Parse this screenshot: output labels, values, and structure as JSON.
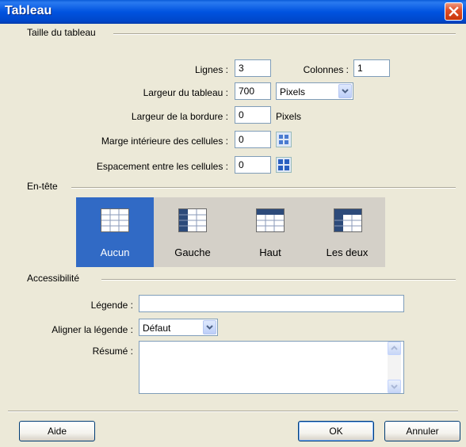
{
  "window": {
    "title": "Tableau"
  },
  "table_size": {
    "legend": "Taille du tableau",
    "rows_label": "Lignes :",
    "rows_value": "3",
    "columns_label": "Colonnes :",
    "columns_value": "1",
    "width_label": "Largeur du tableau :",
    "width_value": "700",
    "width_unit": "Pixels",
    "border_label": "Largeur de la bordure :",
    "border_value": "0",
    "border_unit": "Pixels",
    "padding_label": "Marge intérieure des cellules :",
    "padding_value": "0",
    "spacing_label": "Espacement entre les cellules :",
    "spacing_value": "0"
  },
  "header": {
    "legend": "En-tête",
    "options": [
      {
        "label": "Aucun",
        "icon": "table-no-header-icon",
        "selected": true
      },
      {
        "label": "Gauche",
        "icon": "table-left-header-icon",
        "selected": false
      },
      {
        "label": "Haut",
        "icon": "table-top-header-icon",
        "selected": false
      },
      {
        "label": "Les deux",
        "icon": "table-both-header-icon",
        "selected": false
      }
    ]
  },
  "accessibility": {
    "legend": "Accessibilité",
    "caption_label": "Légende :",
    "caption_value": "",
    "align_label": "Aligner la légende :",
    "align_value": "Défaut",
    "summary_label": "Résumé :",
    "summary_value": ""
  },
  "buttons": {
    "help": "Aide",
    "ok": "OK",
    "cancel": "Annuler"
  },
  "colors": {
    "title_bar": "#0053e0",
    "selected": "#316ac5",
    "dialog_bg": "#ece9d8"
  }
}
